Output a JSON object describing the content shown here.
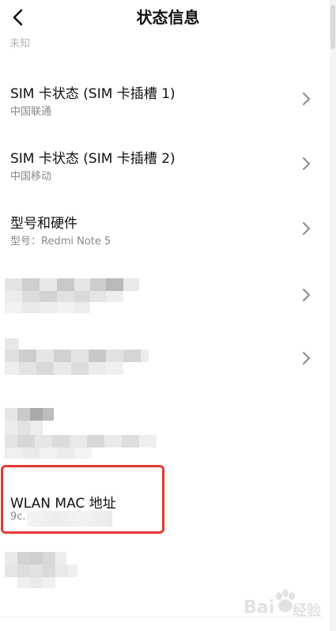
{
  "header": {
    "title": "状态信息"
  },
  "top_partial_text": "未知",
  "items": [
    {
      "title": "SIM 卡状态 (SIM 卡插槽 1)",
      "subtitle": "中国联通"
    },
    {
      "title": "SIM 卡状态 (SIM 卡插槽 2)",
      "subtitle": "中国移动"
    },
    {
      "title": "型号和硬件",
      "subtitle": "型号：Redmi Note 5"
    }
  ],
  "wlan": {
    "title": "WLAN MAC 地址",
    "value_prefix": "9c."
  },
  "watermark": {
    "text": "Bai",
    "text2": "经验"
  },
  "colors": {
    "highlight": "#e53935",
    "text": "#111111",
    "subtext": "#888888"
  }
}
